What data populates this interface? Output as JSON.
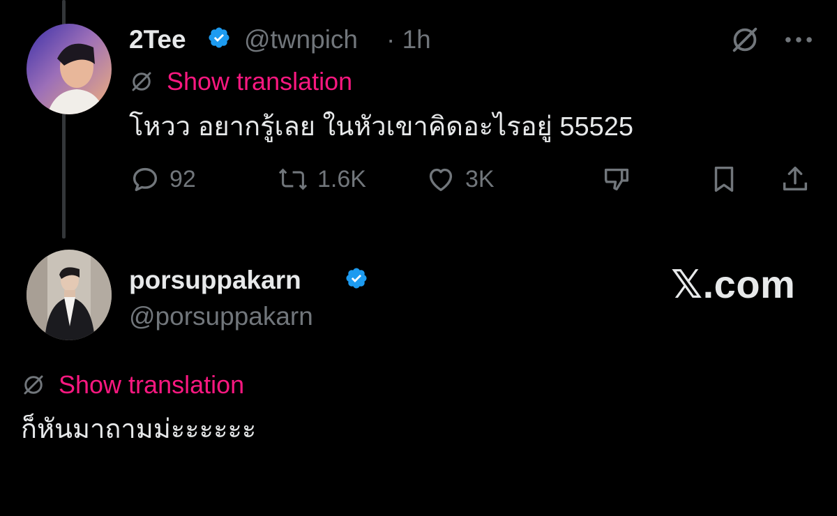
{
  "tweet": {
    "author_name": "2Tee",
    "author_handle": "@twnpich",
    "time": "· 1h",
    "translate_label": "Show translation",
    "text": "โหวว อยากรู้เลย ในหัวเขาคิดอะไรอยู่ 55525",
    "stats": {
      "replies": "92",
      "reposts": "1.6K",
      "likes": "3K"
    }
  },
  "reply": {
    "author_name": "porsuppakarn",
    "author_handle": "@porsuppakarn",
    "translate_label": "Show translation",
    "text": "ก็หันมาถามม่ะะะะะะ"
  },
  "watermark": "𝕏.com",
  "colors": {
    "background": "#000000",
    "text": "#e7e9ea",
    "muted": "#71767b",
    "link": "#f91880",
    "verified": "#1d9bf0"
  },
  "icons": [
    "grok-icon",
    "more-icon",
    "translate-icon",
    "reply-icon",
    "repost-icon",
    "like-icon",
    "dislike-icon",
    "bookmark-icon",
    "share-icon",
    "verified-badge-icon"
  ]
}
